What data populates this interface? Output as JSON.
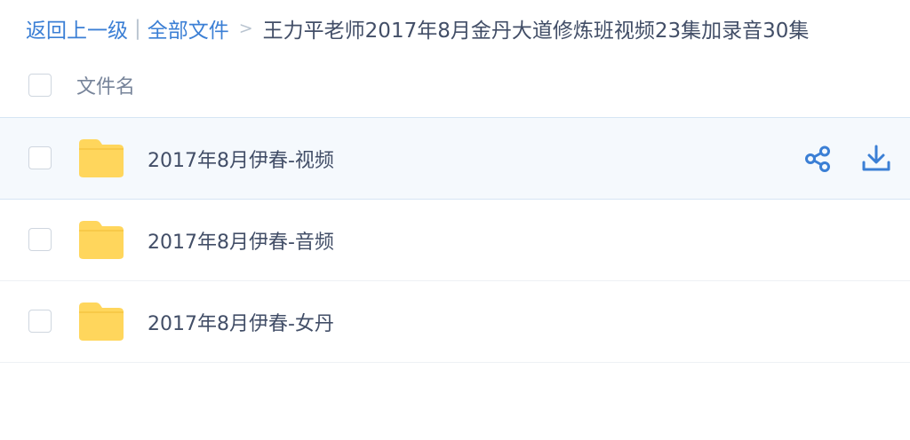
{
  "breadcrumb": {
    "back_label": "返回上一级",
    "separator": "|",
    "all_files_label": "全部文件",
    "arrow": ">",
    "current_folder": "王力平老师2017年8月金丹大道修炼班视频23集加录音30集"
  },
  "list_header": {
    "name_label": "文件名"
  },
  "files": [
    {
      "name": "2017年8月伊春-视频",
      "type": "folder",
      "icon": "folder-icon"
    },
    {
      "name": "2017年8月伊春-音频",
      "type": "folder",
      "icon": "folder-icon"
    },
    {
      "name": "2017年8月伊春-女丹",
      "type": "folder",
      "icon": "folder-icon"
    }
  ],
  "row_actions": {
    "share_icon": "share-icon",
    "download_icon": "download-icon"
  },
  "colors": {
    "accent": "#3b7fd5",
    "text": "#424e67",
    "muted": "#77849a",
    "folder": "#ffd65c",
    "hover_row": "#f5f9fd"
  }
}
